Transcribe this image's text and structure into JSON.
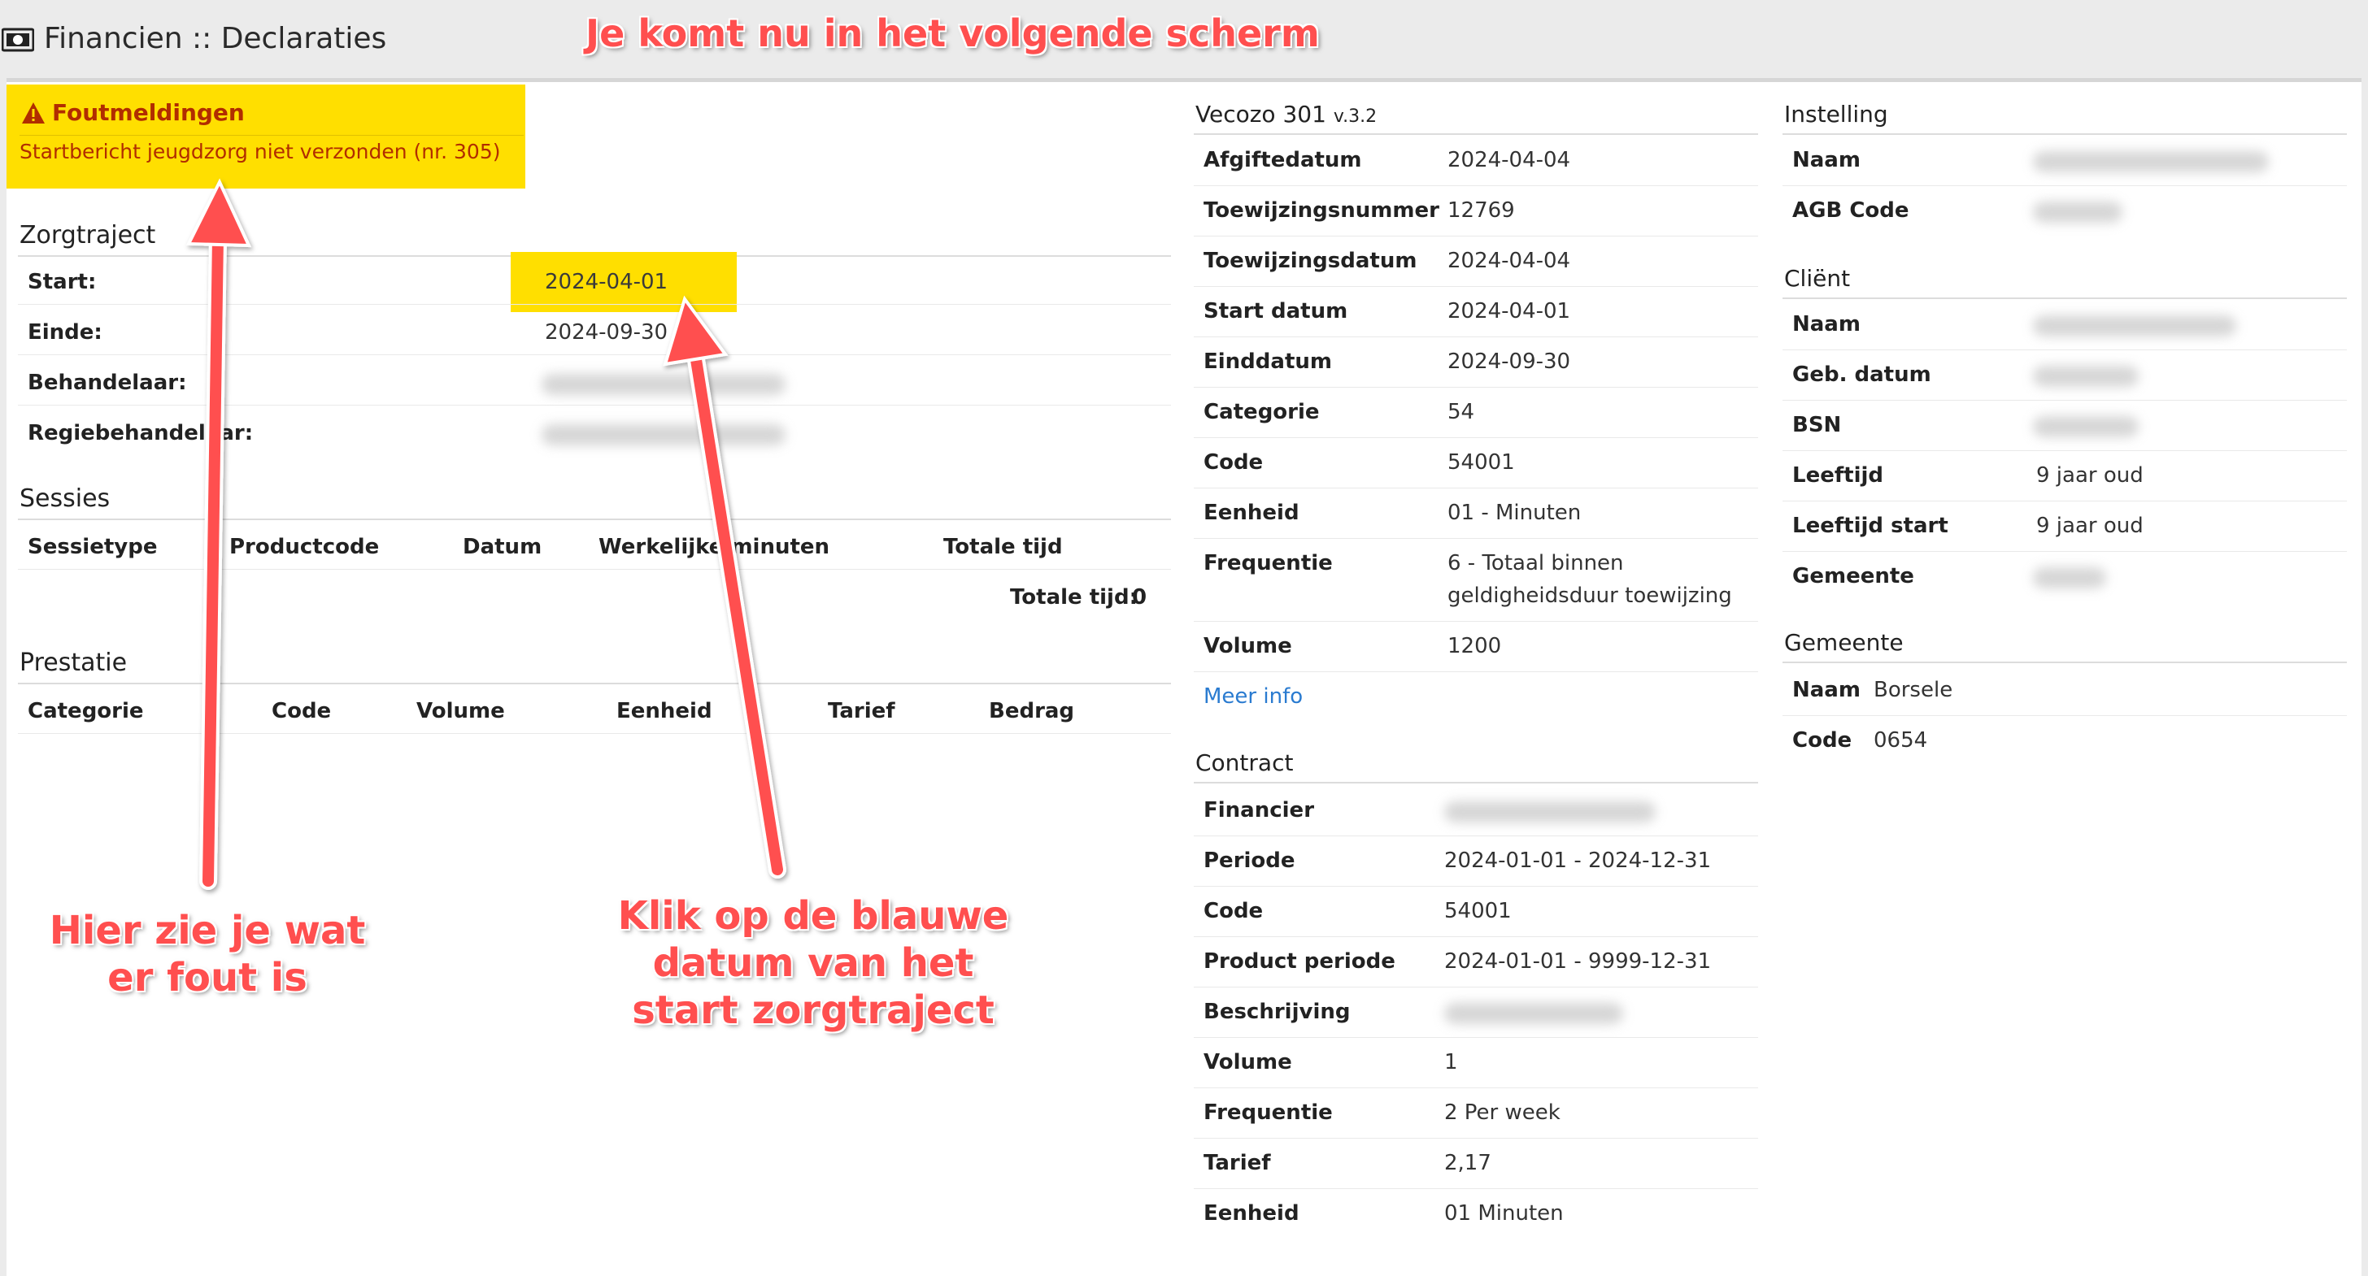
{
  "header": {
    "title": "Financien :: Declaraties",
    "icon": "money-icon"
  },
  "annotations": {
    "top": "Je komt nu in het volgende scherm",
    "left": "Hier zie je wat er fout is",
    "middle": "Klik op de blauwe datum van het start zorgtraject",
    "color": "#ff4f4f"
  },
  "errors": {
    "title": "Foutmeldingen",
    "message": "Startbericht jeugdzorg niet verzonden (nr. 305)",
    "icon": "warning-icon"
  },
  "zorgtraject": {
    "title": "Zorgtraject",
    "rows": [
      {
        "label": "Start:",
        "value": "2024-04-01"
      },
      {
        "label": "Einde:",
        "value": "2024-09-30"
      },
      {
        "label": "Behandelaar:",
        "value": ""
      },
      {
        "label": "Regiebehandelaar:",
        "value": ""
      }
    ]
  },
  "sessies": {
    "title": "Sessies",
    "columns": [
      "Sessietype",
      "Productcode",
      "Datum",
      "Werkelijke minuten",
      "Totale tijd"
    ],
    "total_label": "Totale tijd:",
    "total_value": "0"
  },
  "prestatie": {
    "title": "Prestatie",
    "columns": [
      "Categorie",
      "Code",
      "Volume",
      "Eenheid",
      "Tarief",
      "Bedrag"
    ]
  },
  "vecozo": {
    "title": "Vecozo 301",
    "version": "v.3.2",
    "rows": [
      {
        "label": "Afgiftedatum",
        "value": "2024-04-04"
      },
      {
        "label": "Toewijzingsnummer",
        "value": "12769"
      },
      {
        "label": "Toewijzingsdatum",
        "value": "2024-04-04"
      },
      {
        "label": "Start datum",
        "value": "2024-04-01"
      },
      {
        "label": "Einddatum",
        "value": "2024-09-30"
      },
      {
        "label": "Categorie",
        "value": "54"
      },
      {
        "label": "Code",
        "value": "54001"
      },
      {
        "label": "Eenheid",
        "value": "01 - Minuten"
      },
      {
        "label": "Frequentie",
        "value": "6 - Totaal binnen",
        "value2": "geldigheidsduur toewijzing"
      },
      {
        "label": "Volume",
        "value": "1200"
      }
    ],
    "more_link": "Meer info"
  },
  "contract": {
    "title": "Contract",
    "rows": [
      {
        "label": "Financier",
        "value": ""
      },
      {
        "label": "Periode",
        "value": "2024-01-01 - 2024-12-31"
      },
      {
        "label": "Code",
        "value": "54001"
      },
      {
        "label": "Product periode",
        "value": "2024-01-01 - 9999-12-31"
      },
      {
        "label": "Beschrijving",
        "value": ""
      },
      {
        "label": "Volume",
        "value": "1"
      },
      {
        "label": "Frequentie",
        "value": "2 Per week"
      },
      {
        "label": "Tarief",
        "value": "2,17"
      },
      {
        "label": "Eenheid",
        "value": "01 Minuten"
      }
    ]
  },
  "instelling": {
    "title": "Instelling",
    "rows": [
      {
        "label": "Naam",
        "value": ""
      },
      {
        "label": "AGB Code",
        "value": ""
      }
    ]
  },
  "client": {
    "title": "Cliënt",
    "rows": [
      {
        "label": "Naam",
        "value": ""
      },
      {
        "label": "Geb. datum",
        "value": ""
      },
      {
        "label": "BSN",
        "value": ""
      },
      {
        "label": "Leeftijd",
        "value": "9 jaar oud"
      },
      {
        "label": "Leeftijd start",
        "value": "9 jaar oud"
      },
      {
        "label": "Gemeente",
        "value": ""
      }
    ]
  },
  "gemeente": {
    "title": "Gemeente",
    "rows": [
      {
        "label": "Naam",
        "value": "Borsele"
      },
      {
        "label": "Code",
        "value": "0654"
      }
    ]
  },
  "colors": {
    "highlight": "#ffdf00",
    "error_text": "#b12d00",
    "link": "#2a7bd0"
  }
}
